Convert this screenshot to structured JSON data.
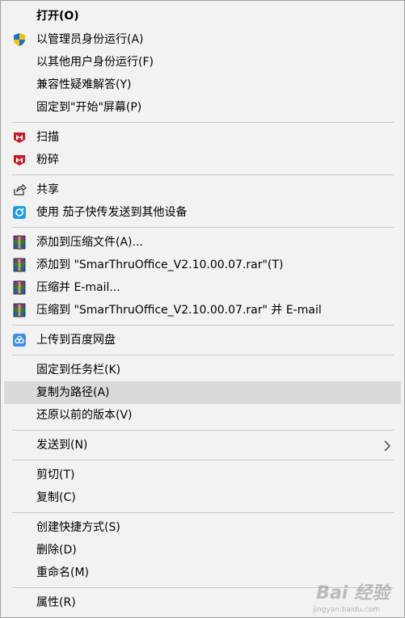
{
  "menu": {
    "open": "打开(O)",
    "run_as_admin": "以管理员身份运行(A)",
    "run_as_other": "以其他用户身份运行(F)",
    "compat": "兼容性疑难解答(Y)",
    "pin_start": "固定到\"开始\"屏幕(P)",
    "scan": "扫描",
    "shred": "粉碎",
    "share": "共享",
    "eggplant": "使用 茄子快传发送到其他设备",
    "add_archive": "添加到压缩文件(A)...",
    "add_rar": "添加到 \"SmarThruOffice_V2.10.00.07.rar\"(T)",
    "compress_email": "压缩并 E-mail...",
    "compress_rar_email": "压缩到 \"SmarThruOffice_V2.10.00.07.rar\" 并 E-mail",
    "upload_baidu": "上传到百度网盘",
    "pin_taskbar": "固定到任务栏(K)",
    "copy_path": "复制为路径(A)",
    "restore": "还原以前的版本(V)",
    "send_to": "发送到(N)",
    "cut": "剪切(T)",
    "copy": "复制(C)",
    "shortcut": "创建快捷方式(S)",
    "delete": "删除(D)",
    "rename": "重命名(M)",
    "properties": "属性(R)"
  },
  "icons": {
    "uac": "uac-shield-icon",
    "mcafee": "mcafee-icon",
    "share": "share-icon",
    "eggplant": "eggplant-share-icon",
    "winrar": "winrar-icon",
    "baidu": "baidu-netdisk-icon",
    "submenu": "chevron-right-icon"
  },
  "colors": {
    "menu_bg": "#f2f2f2",
    "hover_bg": "#dadada",
    "separator": "#c8c8c8",
    "mcafee_red": "#c0202e",
    "eggplant_blue": "#1aa0e8",
    "baidu_blue": "#3a8ee6"
  },
  "watermark": {
    "text": "Bai 经验",
    "sub": "jingyan.baidu.com"
  }
}
